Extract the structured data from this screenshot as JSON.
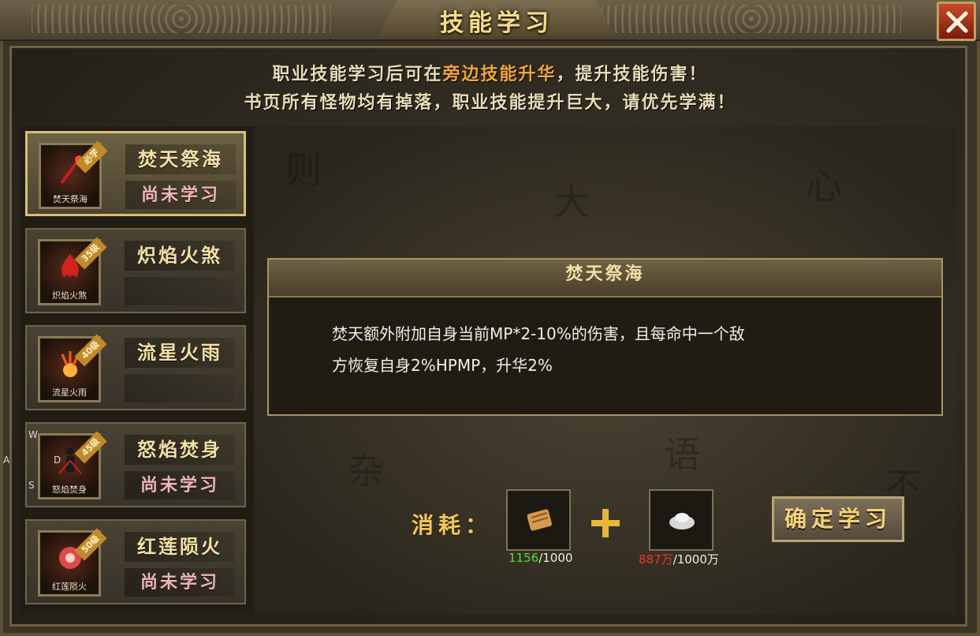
{
  "window": {
    "title": "技能学习",
    "close_label": "✕"
  },
  "notice": {
    "line1_before": "职业技能学习后可在",
    "line1_highlight": "旁边技能升华",
    "line1_after": "，提升技能伤害！",
    "line2": "书页所有怪物均有掉落，职业技能提升巨大，请优先学满！"
  },
  "skills": [
    {
      "name": "焚天祭海",
      "icon_caption": "焚天祭海",
      "badge": "必学",
      "status": "尚未学习",
      "selected": true
    },
    {
      "name": "炽焰火煞",
      "icon_caption": "炽焰火煞",
      "badge": "35级",
      "status": ""
    },
    {
      "name": "流星火雨",
      "icon_caption": "流星火雨",
      "badge": "40级",
      "status": ""
    },
    {
      "name": "怒焰焚身",
      "icon_caption": "怒焰焚身",
      "badge": "45级",
      "status": "尚未学习"
    },
    {
      "name": "红莲陨火",
      "icon_caption": "红莲陨火",
      "badge": "50级",
      "status": "尚未学习"
    }
  ],
  "detail": {
    "title": "焚天祭海",
    "line1": "焚天额外附加自身当前MP*2-10%的伤害，且每命中一个敌",
    "line2": "方恢复自身2%HPMP，升华2%"
  },
  "cost": {
    "label": "消耗：",
    "item1": {
      "icon": "scroll-icon",
      "have": "1156",
      "need": "/1000"
    },
    "item2": {
      "icon": "silver-ingot-icon",
      "have": "887万",
      "need": "/1000万"
    }
  },
  "confirm_button": "确定学习",
  "overlay_keys": {
    "w": "W",
    "a": "A",
    "d": "D",
    "s": "S"
  },
  "colors": {
    "accent": "#f0a53a",
    "have_ok": "#48e236",
    "have_short": "#e73a2a"
  }
}
